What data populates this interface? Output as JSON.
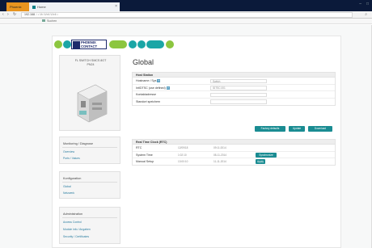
{
  "browser": {
    "tabs": [
      {
        "label": "Phoenix"
      },
      {
        "label": "Home"
      }
    ],
    "tab_close": "×",
    "address": {
      "host": "192.168.",
      "path": "/ • Mr.Welt.Welt •"
    },
    "bookmark": "Suchen"
  },
  "brand": {
    "name": "PHOENIX CONTACT"
  },
  "sidebar": {
    "product_title": "FL SWITCH SMCS 8GT\nPN24",
    "sections": [
      {
        "heading": "Monitoring / Diagnose",
        "links": [
          "Overview",
          "Ports / Values"
        ]
      },
      {
        "heading": "Konfiguration",
        "links": [
          "Global",
          "Netzwerk"
        ]
      },
      {
        "heading": "Administration",
        "links": [
          "Access Control",
          "Module info / Angaben",
          "Security / Certificates"
        ]
      }
    ]
  },
  "main": {
    "title": "Global",
    "panel1": {
      "heading": "Host Station",
      "rows": [
        {
          "label": "Hostname / Sys",
          "value": "Switch"
        },
        {
          "label": "IntIDTSC (use defined)",
          "value": "IDTSC.001"
        },
        {
          "label": "Kontaktadresse",
          "value": ""
        },
        {
          "label": "Standort speichern",
          "value": ""
        }
      ],
      "buttons": [
        "Factory defaults",
        "Update",
        "Download"
      ]
    },
    "panel2": {
      "heading": "Real Time Clock (RTC)",
      "rows": [
        {
          "label": "RTC",
          "col1": "12/09/18",
          "col2": "09:11:2014",
          "button": ""
        },
        {
          "label": "System Time",
          "col1": "1:02:10",
          "col2": "08-11-2014",
          "button": "Synchronize"
        },
        {
          "label": "Manual Setup",
          "col1": "13:00:10",
          "col2": "11-11-2014",
          "button": "Apply"
        }
      ]
    }
  },
  "colors": {
    "accent": "#1a8c92",
    "brand_navy": "#1d2a6b",
    "green": "#8cc63f",
    "teal": "#1aa6a6",
    "chrome": "#0b1a3a"
  }
}
